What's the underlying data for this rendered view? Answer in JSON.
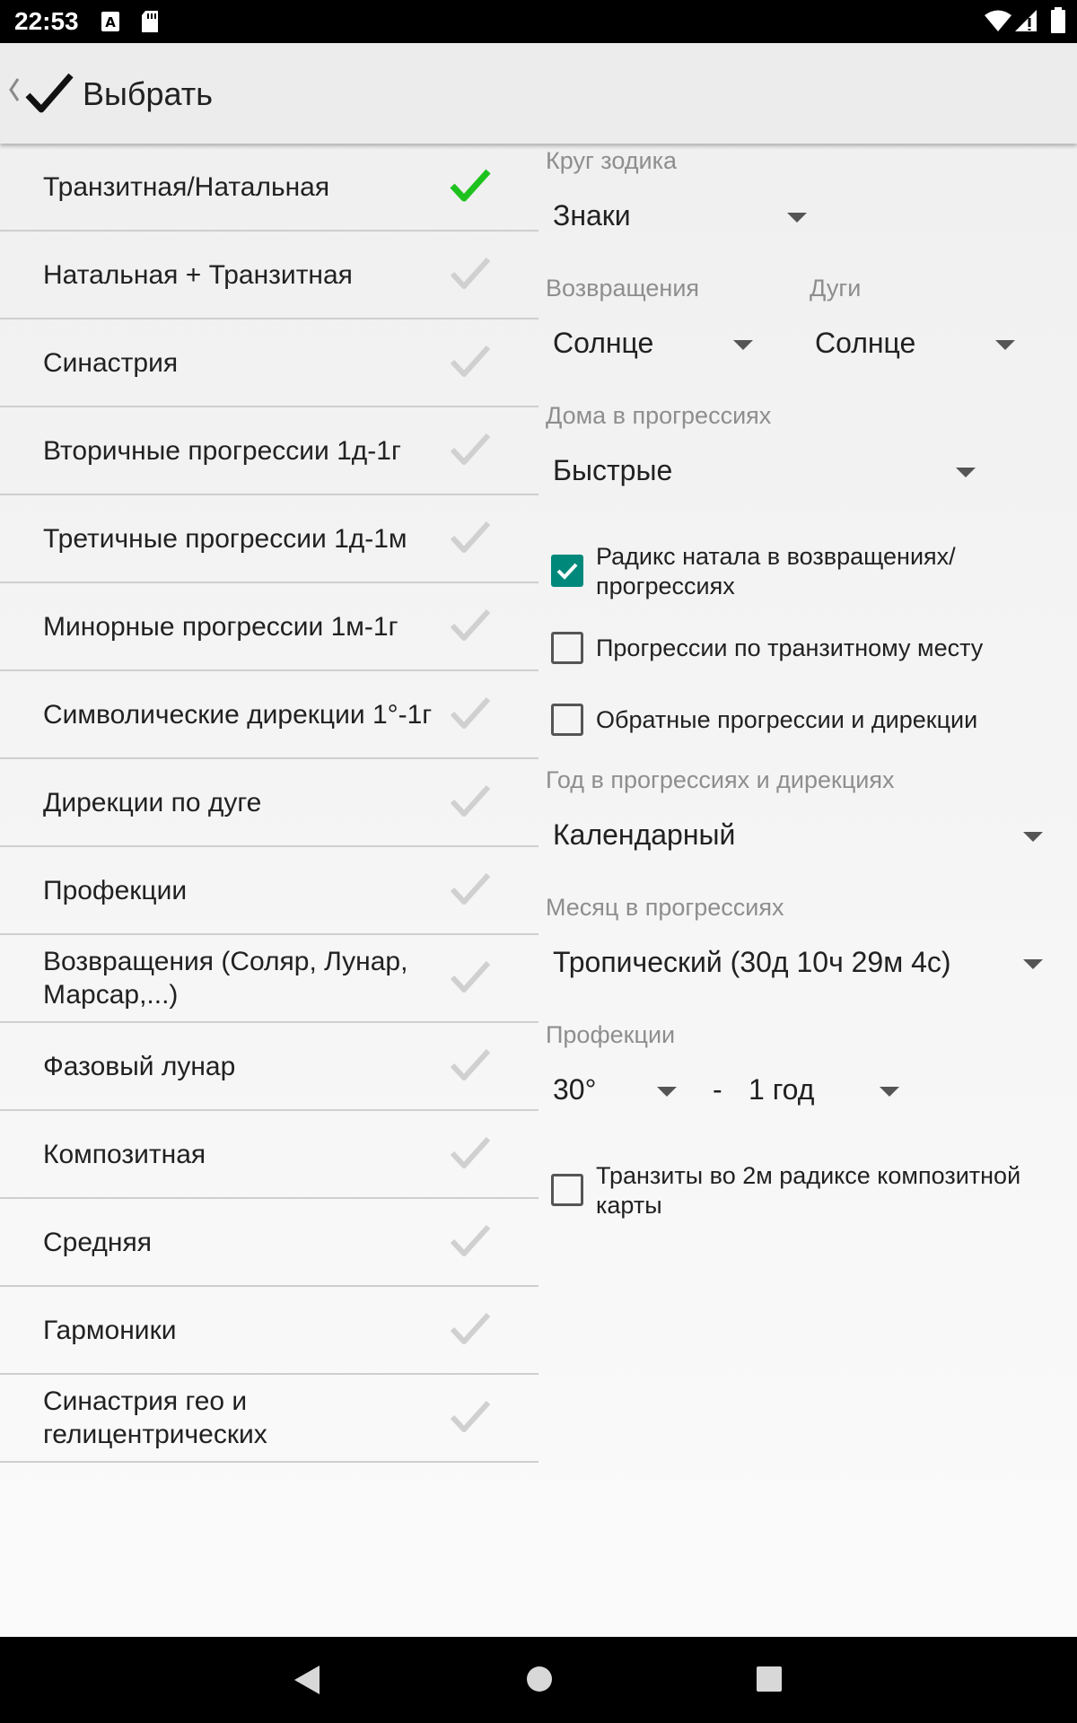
{
  "status_bar": {
    "time": "22:53",
    "icons": [
      "text-a-icon",
      "sd-card-icon",
      "wifi-icon",
      "signal-icon",
      "battery-icon"
    ]
  },
  "toolbar": {
    "title": "Выбрать",
    "back_icon": "chevron-left-icon",
    "confirm_icon": "check-icon"
  },
  "chart_types": [
    {
      "label": "Транзитная/Натальная",
      "selected": true
    },
    {
      "label": "Натальная + Транзитная",
      "selected": false
    },
    {
      "label": "Синастрия",
      "selected": false
    },
    {
      "label": "Вторичные прогрессии 1д-1г",
      "selected": false
    },
    {
      "label": "Третичные прогрессии 1д-1м",
      "selected": false
    },
    {
      "label": "Минорные прогрессии 1м-1г",
      "selected": false
    },
    {
      "label": "Символические дирекции 1°-1г",
      "selected": false
    },
    {
      "label": "Дирекции по дуге",
      "selected": false
    },
    {
      "label": "Профекции",
      "selected": false
    },
    {
      "label": "Возвращения (Соляр, Лунар, Марсар,...)",
      "selected": false
    },
    {
      "label": "Фазовый лунар",
      "selected": false
    },
    {
      "label": "Композитная",
      "selected": false
    },
    {
      "label": "Средняя",
      "selected": false
    },
    {
      "label": "Гармоники",
      "selected": false
    },
    {
      "label": "Синастрия гео и гелицентрических",
      "selected": false
    }
  ],
  "settings": {
    "zodiac_circle": {
      "label": "Круг зодика",
      "value": "Знаки"
    },
    "returns": {
      "label": "Возвращения",
      "value": "Солнце"
    },
    "arcs": {
      "label": "Дуги",
      "value": "Солнце"
    },
    "progression_houses": {
      "label": "Дома в прогрессиях",
      "value": "Быстрые"
    },
    "checkbox_radix": {
      "label": "Радикс натала в возвращениях/ прогрессиях",
      "checked": true
    },
    "checkbox_transit_place": {
      "label": "Прогрессии по транзитному месту",
      "checked": false
    },
    "checkbox_reverse": {
      "label": "Обратные прогрессии и дирекции",
      "checked": false
    },
    "progression_year": {
      "label": "Год в прогрессиях и дирекциях",
      "value": "Календарный"
    },
    "progression_month": {
      "label": "Месяц в прогрессиях",
      "value": "Тропический (30д 10ч 29м 4с)"
    },
    "profections": {
      "label": "Профекции",
      "degree_value": "30°",
      "separator": "-",
      "period_value": "1 год"
    },
    "checkbox_composite": {
      "label": "Транзиты во 2м радиксе композитной карты",
      "checked": false
    }
  },
  "colors": {
    "selected_check": "#1ec21e",
    "unselected_check": "#d0d0d0",
    "checkbox_on": "#00897b"
  }
}
